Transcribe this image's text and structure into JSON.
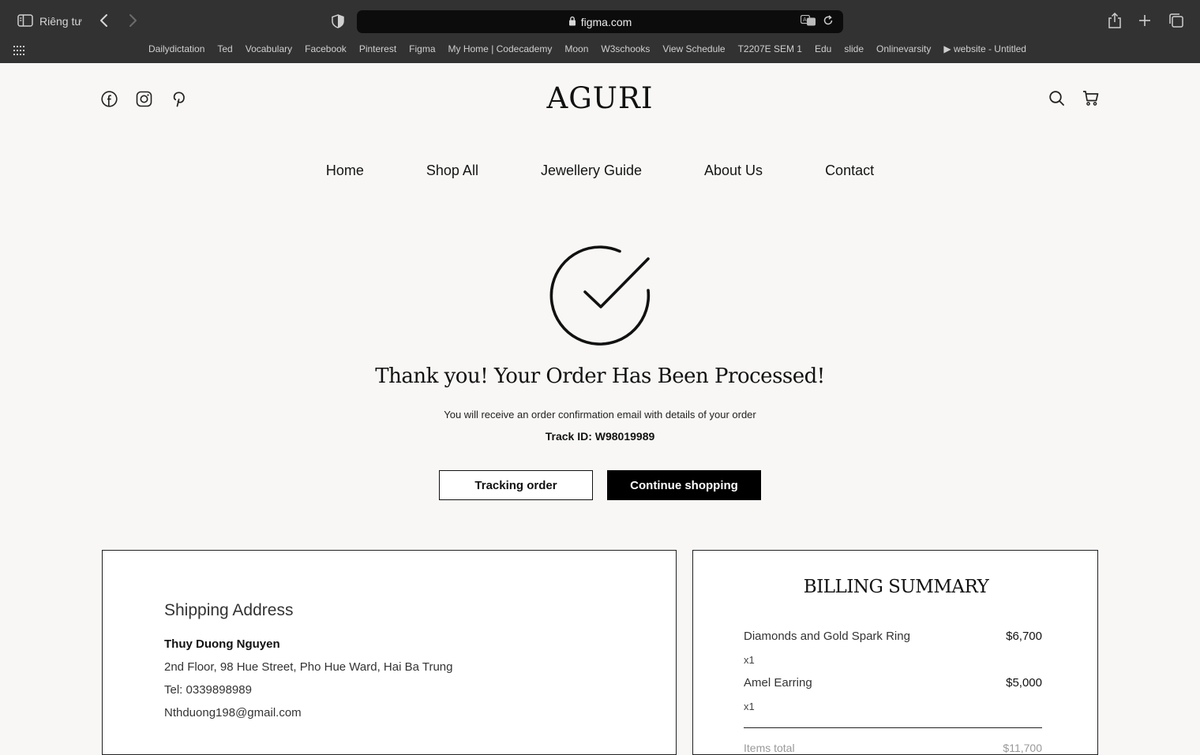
{
  "browser": {
    "private_label": "Riêng tư",
    "url": "figma.com",
    "bookmarks": [
      "Dailydictation",
      "Ted",
      "Vocabulary",
      "Facebook",
      "Pinterest",
      "Figma",
      "My Home | Codecademy",
      "Moon",
      "W3schooks",
      "View Schedule",
      "T2207E SEM 1",
      "Edu",
      "slide",
      "Onlinevarsity",
      "▶ website - Untitled"
    ]
  },
  "header": {
    "logo": "AGURI",
    "social_icons": [
      "facebook-icon",
      "instagram-icon",
      "pinterest-icon"
    ],
    "right_icons": [
      "search-icon",
      "cart-icon"
    ]
  },
  "nav": {
    "items": [
      "Home",
      "Shop All",
      "Jewellery Guide",
      "About Us",
      "Contact"
    ]
  },
  "confirmation": {
    "icon": "check-circle-icon",
    "title": "Thank you! Your Order Has Been Processed!",
    "subtitle": "You will receive an order confirmation email with details of your order",
    "track_id": "Track ID: W98019989",
    "tracking_button": "Tracking order",
    "continue_button": "Continue shopping"
  },
  "shipping": {
    "title": "Shipping Address",
    "name": "Thuy Duong Nguyen",
    "address": "2nd Floor, 98 Hue Street, Pho Hue Ward, Hai Ba Trung",
    "tel": "Tel: 0339898989",
    "email": "Nthduong198@gmail.com"
  },
  "billing": {
    "title": "BILLING SUMMARY",
    "items": [
      {
        "name": "Diamonds and Gold Spark Ring",
        "price": "$6,700",
        "qty": "x1"
      },
      {
        "name": "Amel Earring",
        "price": "$5,000",
        "qty": "x1"
      }
    ],
    "total_label": "Items total",
    "total_value": "$11,700"
  },
  "colors": {
    "page_bg": "#f8f7f5",
    "chrome_bg": "#323232",
    "primary": "#000000"
  }
}
